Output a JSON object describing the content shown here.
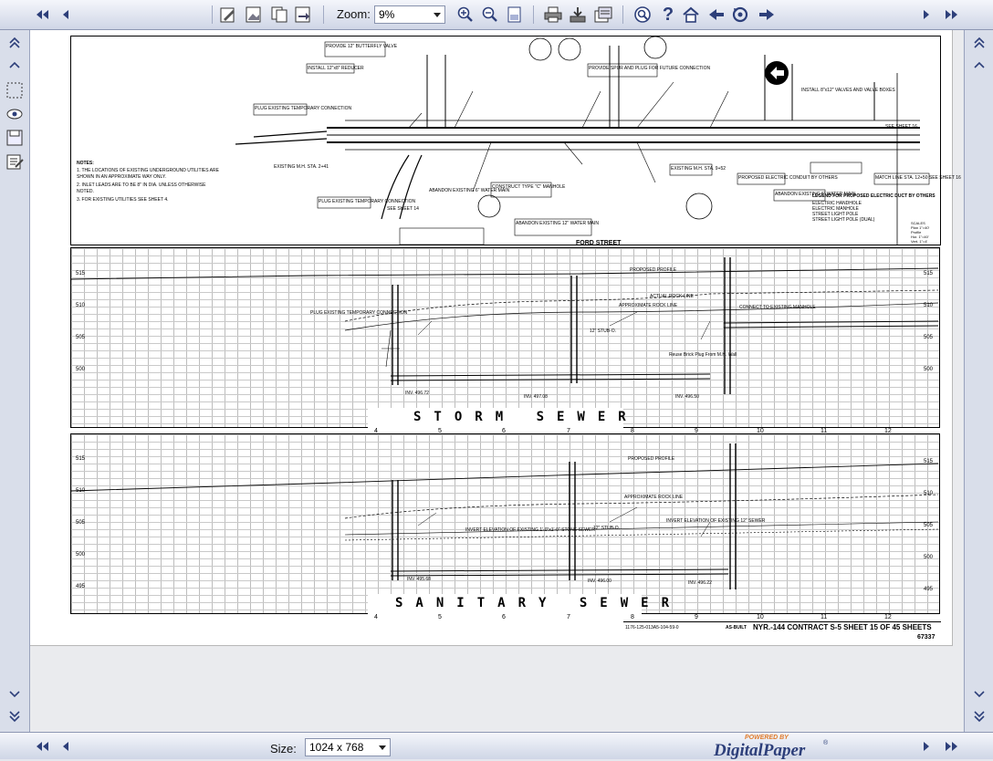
{
  "toolbar": {
    "zoom_label": "Zoom:",
    "zoom_value": "9%"
  },
  "bottom": {
    "size_label": "Size:",
    "size_value": "1024 x 768",
    "powered_by": "POWERED BY",
    "brand": "DigitalPaper"
  },
  "icons": {
    "top": [
      "first-page-icon",
      "previous-page-icon",
      "annotate-icon",
      "image-icon",
      "copy-icon",
      "export-icon",
      "zoom-in-icon",
      "zoom-out-icon",
      "fit-page-icon",
      "print-icon",
      "download-icon",
      "properties-icon",
      "search-icon",
      "help-icon",
      "home-icon",
      "back-icon",
      "refresh-icon",
      "forward-icon",
      "next-page-icon",
      "last-page-icon"
    ],
    "left": [
      "scroll-top-icon",
      "scroll-up-icon",
      "select-area-icon",
      "view-icon",
      "save-icon",
      "notes-icon",
      "scroll-down-icon",
      "scroll-bottom-icon"
    ],
    "right": [
      "scroll-top-icon",
      "scroll-up-icon",
      "scroll-down-icon",
      "scroll-bottom-icon"
    ]
  },
  "drawing": {
    "street": "FORD STREET",
    "storm_title": "STORM SEWER",
    "sanitary_title": "SANITARY SEWER",
    "title_block": "NYR.-144 CONTRACT S-5 SHEET 15 OF 45 SHEETS",
    "drawing_code": "1176-125-013A5-104-59-0",
    "as_built": "AS-BUILT",
    "sheet_number": "67337",
    "storm_elevations": [
      "515",
      "510",
      "505",
      "500"
    ],
    "sanitary_elevations": [
      "515",
      "510",
      "505",
      "500",
      "495"
    ],
    "stations": [
      "4",
      "5",
      "6",
      "7",
      "8",
      "9",
      "10",
      "11",
      "12"
    ],
    "notes": [
      "NOTES:",
      "1. THE LOCATIONS OF EXISTING UNDERGROUND UTILITIES ARE SHOWN IN AN APPROXIMATE WAY ONLY.",
      "2. INLET LEADS ARE TO BE 8\" IN DIA. UNLESS OTHERWISE NOTED.",
      "3. FOR EXISTING UTILITIES SEE SHEET 4."
    ],
    "legend": [
      "LEGEND FOR PROPOSED ELECTRIC DUCT BY OTHERS",
      "ELECTRIC HANDHOLE",
      "ELECTRIC MANHOLE",
      "STREET LIGHT POLE",
      "STREET LIGHT POLE (DUAL)"
    ],
    "scales": [
      "SCALES",
      "Plan 1\"=40'",
      "Profile",
      "Hor. 1\"=40'",
      "Vert. 1\"=4'"
    ],
    "plan_callouts": [
      "PROVIDE 12\" BUTTERFLY VALVE",
      "INSTALL 12\"x8\" REDUCER",
      "PLUG EXISTING TEMPORARY CONNECTION",
      "EXISTING M.H. STA. 2+41",
      "PLUG EXISTING TEMPORARY CONNECTION",
      "ABANDON EXISTING 6\" WATER MAIN",
      "SEE SHEET 14",
      "CONSTRUCT TYPE \"C\" MANHOLE",
      "ABANDON EXISTING 12\" WATER MAIN",
      "PROVIDE SPUR AND PLUG FOR FUTURE CONNECTION",
      "EXISTING M.H. STA. 9+52",
      "PROPOSED ELECTRIC CONDUIT BY OTHERS",
      "ABANDON EXISTING 6\" WATER MAIN",
      "INSTALL 8\"x12\" VALVES AND VALVE BOXES",
      "SEE SHEET 16",
      "MATCH LINE STA. 12+50 SEE SHEET 16"
    ],
    "profile_callouts": [
      "PROPOSED PROFILE",
      "ACTUAL ROCK LINE",
      "APPROXIMATE ROCK LINE",
      "12\" STUB-O.",
      "CONNECT TO EXISTING MANHOLE",
      "Reuse Brick Plug From M.H. Wall",
      "PLUG EXISTING TEMPORARY CONNECTION",
      "INV. 496.72",
      "INV. 497.08",
      "INV. 496.50",
      "PROPOSED PROFILE",
      "APPROXIMATE ROCK LINE",
      "INVERT ELEVATION OF EXISTING 1'-0\"x1'-0\" STONE SEWER",
      "INVERT ELEVATION OF EXISTING 12\" SEWER",
      "12\" STUB-O.",
      "INV. 495.68",
      "INV. 496.00",
      "INV. 496.22"
    ]
  }
}
